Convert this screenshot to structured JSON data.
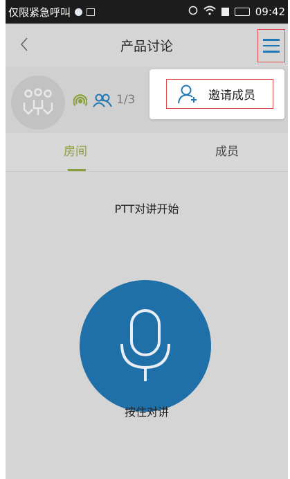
{
  "status_bar": {
    "carrier": "仅限紧急呼叫",
    "time": "09:42"
  },
  "header": {
    "title": "产品讨论"
  },
  "room": {
    "member_count": "1/3"
  },
  "popup": {
    "invite_label": "邀请成员"
  },
  "tabs": [
    {
      "label": "房间",
      "active": true
    },
    {
      "label": "成员",
      "active": false
    }
  ],
  "ptt": {
    "status": "PTT对讲开始",
    "hold_label": "按住对讲"
  },
  "colors": {
    "accent_green": "#8aa13b",
    "primary_blue": "#1f6fa8",
    "highlight_red": "#e24b4b"
  },
  "icons": [
    "back-icon",
    "menu-icon",
    "group-avatar-icon",
    "signal-icon",
    "members-icon",
    "add-user-icon",
    "microphone-icon"
  ]
}
